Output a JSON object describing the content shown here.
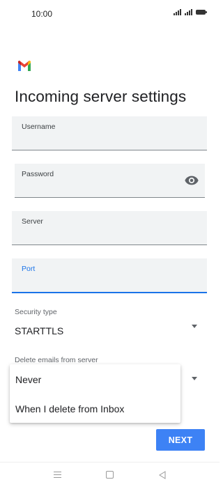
{
  "status_bar": {
    "time": "10:00"
  },
  "header": {
    "title": "Incoming server settings"
  },
  "fields": {
    "username": {
      "label": "Username"
    },
    "password": {
      "label": "Password"
    },
    "server": {
      "label": "Server"
    },
    "port": {
      "label": "Port"
    }
  },
  "security": {
    "label": "Security type",
    "value": "STARTTLS"
  },
  "delete_emails": {
    "label": "Delete emails from server",
    "options": [
      "Never",
      "When I delete from Inbox"
    ]
  },
  "footer": {
    "next_label": "NEXT"
  },
  "colors": {
    "accent": "#1a73e8",
    "button": "#3d82f5",
    "field_bg": "#f1f3f4"
  },
  "icons": [
    "signal-icon",
    "battery-icon",
    "gmail-logo",
    "eye-icon",
    "dropdown-arrow-icon",
    "nav-menu-icon",
    "nav-home-icon",
    "nav-back-icon"
  ]
}
